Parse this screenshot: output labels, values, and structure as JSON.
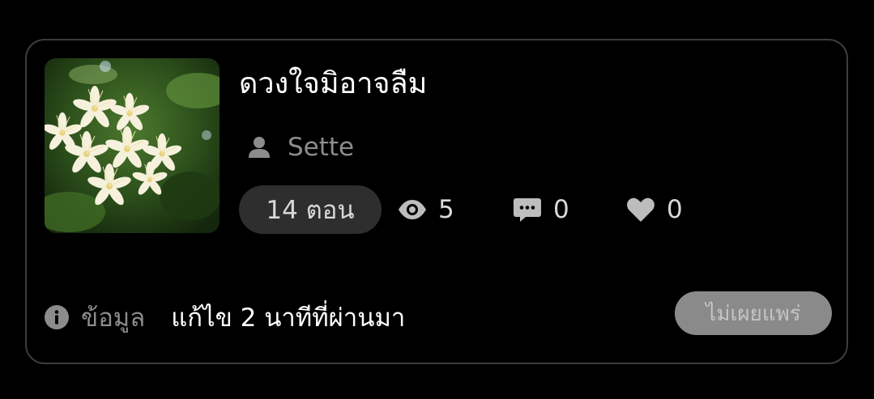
{
  "story": {
    "title": "ดวงใจมิอาจลืม",
    "cover_image": "white-star-flowers-photo",
    "author": {
      "icon": "person-icon",
      "name": "Sette"
    },
    "stats": {
      "episodes_label": "14 ตอน",
      "views": {
        "icon": "eye-icon",
        "value": "5"
      },
      "comments": {
        "icon": "comment-icon",
        "value": "0"
      },
      "likes": {
        "icon": "heart-icon",
        "value": "0"
      }
    },
    "info": {
      "icon": "info-icon",
      "label": "ข้อมูล",
      "edited": "แก้ไข 2 นาทีที่ผ่านมา"
    },
    "status_button": "ไม่เผยแพร่"
  },
  "colors": {
    "background": "#000000",
    "card_border": "#3c3c3c",
    "muted_text": "#8c8c8c",
    "pill_bg": "#2e2e2e",
    "status_button_bg": "#8a8a8a"
  }
}
